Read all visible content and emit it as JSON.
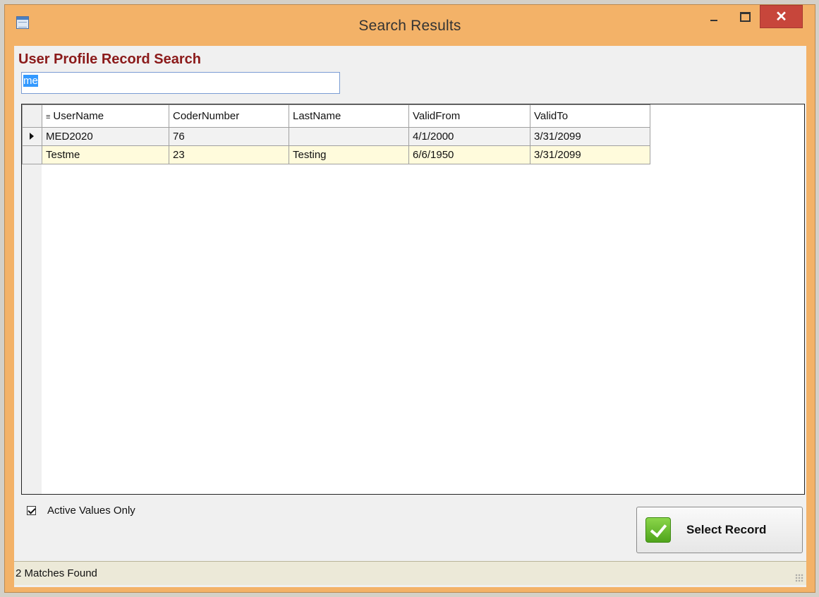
{
  "window": {
    "title": "Search Results",
    "controls": {
      "minimize_icon": "minimize-icon",
      "maximize_icon": "maximize-icon",
      "close_label": "✕"
    }
  },
  "form": {
    "heading": "User Profile Record Search",
    "search_value": "me"
  },
  "grid": {
    "columns": [
      "UserName",
      "CoderNumber",
      "LastName",
      "ValidFrom",
      "ValidTo"
    ],
    "rows": [
      [
        "MED2020",
        "76",
        "",
        "4/1/2000",
        "3/31/2099"
      ],
      [
        "Testme",
        "23",
        "Testing",
        "6/6/1950",
        "3/31/2099"
      ]
    ],
    "current_row": 0
  },
  "filters": {
    "active_only_label": "Active Values Only",
    "active_only_checked": true
  },
  "actions": {
    "select_label": "Select Record"
  },
  "status": {
    "text": "2 Matches Found"
  },
  "colors": {
    "frame": "#f3b268",
    "heading": "#8b1a1a",
    "close_button": "#c7463b",
    "alt_row": "#fffbdc",
    "selection": "#3399ff"
  }
}
